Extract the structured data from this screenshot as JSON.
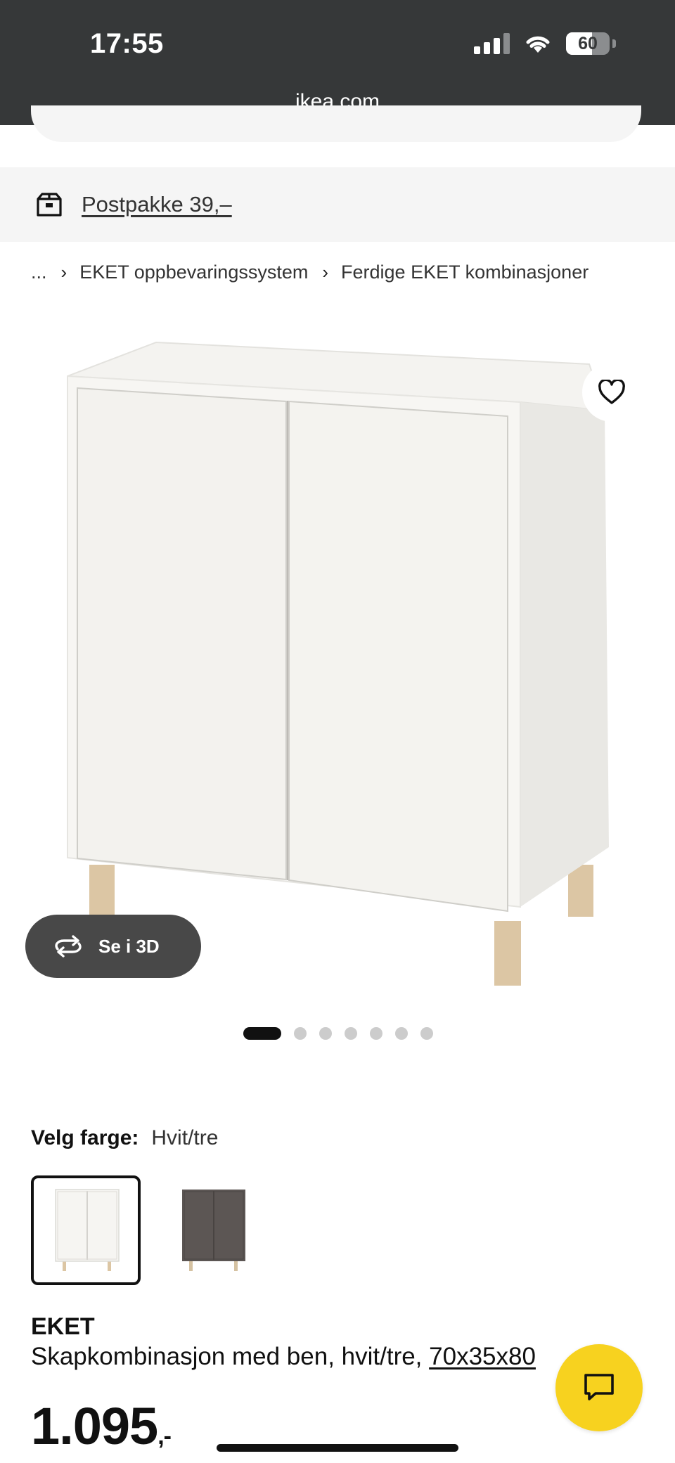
{
  "status_bar": {
    "time": "17:55",
    "battery_percent": "60",
    "battery_level": 0.6,
    "url": "ikea.com"
  },
  "delivery": {
    "icon": "parcel-icon",
    "text": "Postpakke 39,–"
  },
  "breadcrumb": {
    "ellipsis": "...",
    "items": [
      "EKET oppbevaringssystem",
      "Ferdige EKET kombinasjoner"
    ],
    "separator": "›"
  },
  "gallery": {
    "view3d_label": "Se i 3D",
    "dot_count": 7,
    "active_index": 0
  },
  "color_picker": {
    "label": "Velg farge:",
    "selected_value": "Hvit/tre",
    "options": [
      "white-wood",
      "dark-grey-wood"
    ]
  },
  "product": {
    "name": "EKET",
    "description": "Skapkombinasjon med ben, hvit/tre,",
    "dimensions": "70x35x80",
    "price_main": "1.095",
    "price_suffix": ",-"
  },
  "colors": {
    "status_bar_bg": "#363839",
    "chat_button": "#f7d21f",
    "banner_bg": "#f5f5f5"
  }
}
